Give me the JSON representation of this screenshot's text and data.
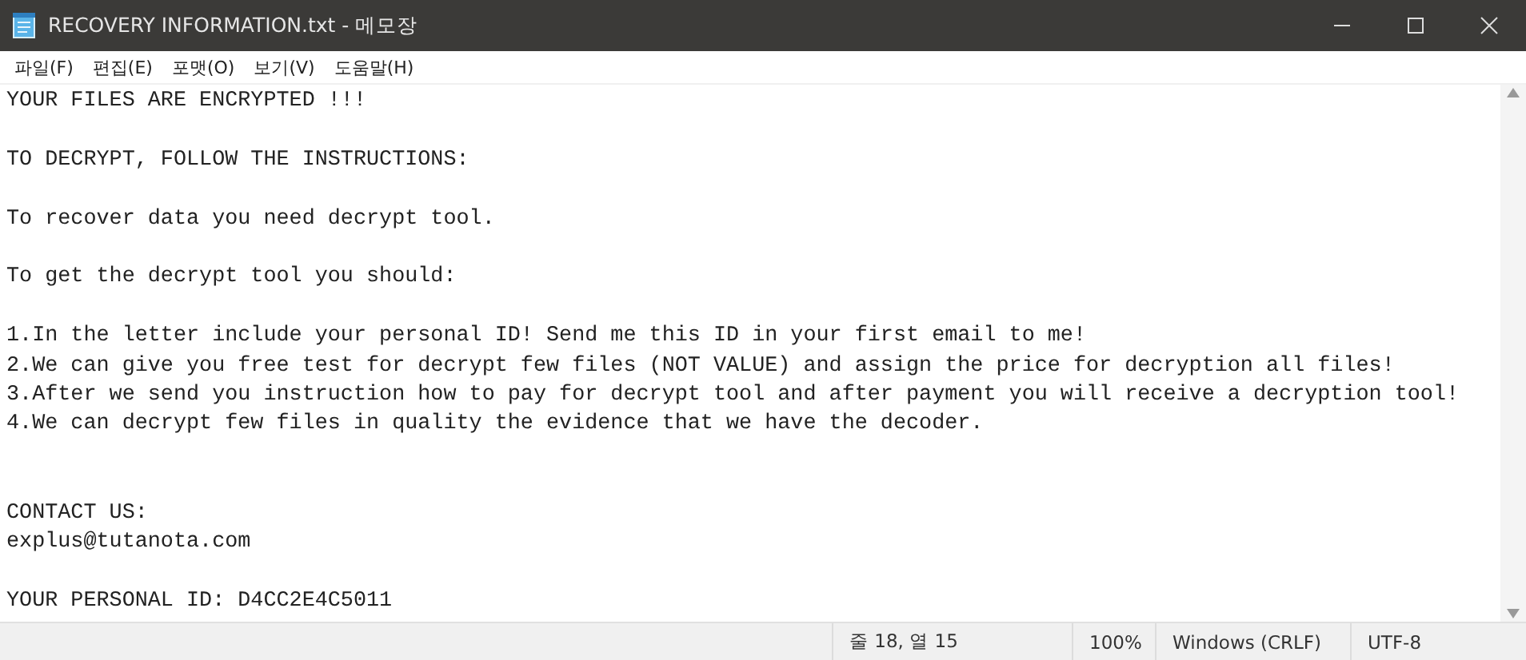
{
  "window": {
    "title": "RECOVERY INFORMATION.txt - 메모장"
  },
  "menu": [
    {
      "label": "파일(F)"
    },
    {
      "label": "편집(E)"
    },
    {
      "label": "포맷(O)"
    },
    {
      "label": "보기(V)"
    },
    {
      "label": "도움말(H)"
    }
  ],
  "document": {
    "blocks": [
      {
        "kind": "single-gap",
        "lines": [
          "YOUR FILES ARE ENCRYPTED !!!"
        ]
      },
      {
        "kind": "single-gap",
        "lines": [
          "TO DECRYPT, FOLLOW THE INSTRUCTIONS:"
        ]
      },
      {
        "kind": "single-gap",
        "lines": [
          "To recover data you need decrypt tool."
        ]
      },
      {
        "kind": "single-gap",
        "lines": [
          "To get the decrypt tool you should:"
        ]
      },
      {
        "kind": "single-gap",
        "lines": [
          "1.In the letter include your personal ID! Send me this ID in your first email to me!",
          "2.We can give you free test for decrypt few files (NOT VALUE) and assign the price for decryption all files!",
          "3.After we send you instruction how to pay for decrypt tool and after payment you will receive a decryption tool!",
          "4.We can decrypt few files in quality the evidence that we have the decoder."
        ]
      },
      {
        "kind": "double-gap",
        "lines": [
          "CONTACT US:",
          "explus@tutanota.com"
        ]
      },
      {
        "kind": "single-gap",
        "lines": [
          "YOUR PERSONAL ID: D4CC2E4C5011"
        ]
      }
    ]
  },
  "status_bar": {
    "position": "줄 18, 열 15",
    "zoom": "100%",
    "line_ending": "Windows (CRLF)",
    "encoding": "UTF-8"
  }
}
